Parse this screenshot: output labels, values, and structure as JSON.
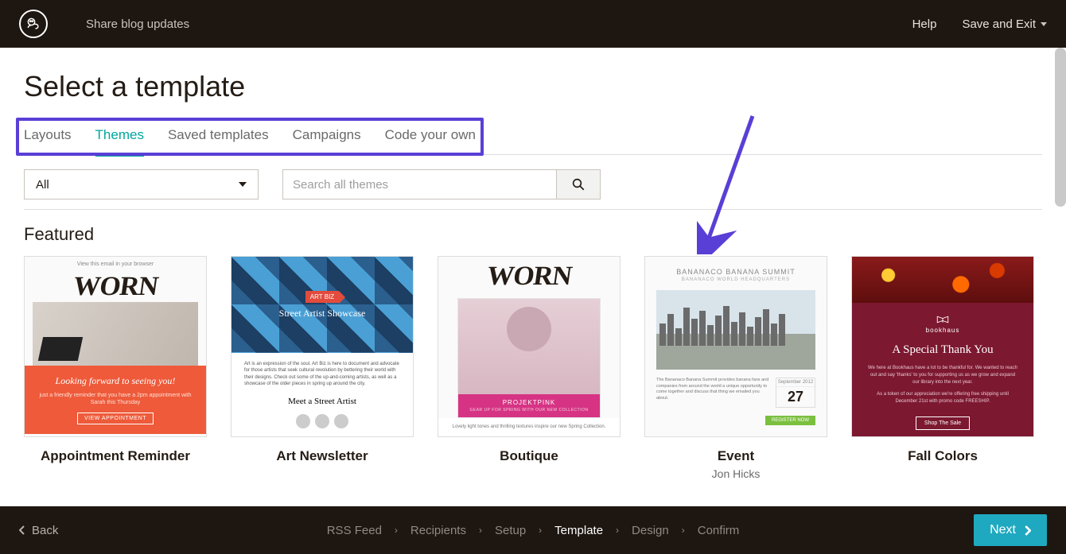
{
  "header": {
    "campaign_name": "Share blog updates",
    "help": "Help",
    "save_exit": "Save and Exit"
  },
  "page": {
    "title": "Select a template"
  },
  "tabs": {
    "layouts": "Layouts",
    "themes": "Themes",
    "saved": "Saved templates",
    "campaigns": "Campaigns",
    "code": "Code your own",
    "active": "themes"
  },
  "filter": {
    "dropdown_value": "All",
    "search_placeholder": "Search all themes"
  },
  "section": {
    "featured": "Featured"
  },
  "templates": [
    {
      "title": "Appointment Reminder",
      "preview": {
        "top_note": "View this email in your browser",
        "logo": "WORN",
        "headline": "Looking forward to seeing you!",
        "body": "just a friendly reminder that you have a 2pm appointment with Sarah this Thursday",
        "button": "VIEW APPOINTMENT"
      }
    },
    {
      "title": "Art Newsletter",
      "preview": {
        "badge": "ART BIZ",
        "hero": "Street Artist Showcase",
        "body": "Art is an expression of the soul. Art Biz is here to document and advocate for those artists that seek cultural revolution by bettering their world with their designs. Check out some of the up-and-coming artists, as well as a showcase of the older pieces in spring up around the city.",
        "subhead": "Meet a Street Artist"
      }
    },
    {
      "title": "Boutique",
      "preview": {
        "logo": "WORN",
        "brand": "PROJEKTPINK",
        "tag": "GEAR UP FOR SPRING WITH OUR NEW COLLECTION",
        "caption": "Lovely light tones and thrilling textures inspire our new Spring Collection."
      }
    },
    {
      "title": "Event",
      "subtitle": "Jon Hicks",
      "preview": {
        "heading": "BANANACO BANANA SUMMIT",
        "subheading": "BANANACO WORLD HEADQUARTERS",
        "body": "The Bananaco Banana Summit provides banana fans and companies from around the world a unique opportunity to come together and discuss that thing we emailed you about.",
        "month": "September 2012",
        "day": "27",
        "button": "REGISTER NOW"
      }
    },
    {
      "title": "Fall Colors",
      "preview": {
        "brand": "bookhaus",
        "headline": "A Special Thank You",
        "body1": "We here at Bookhaus have a lot to be thankful for. We wanted to reach out and say 'thanks' to you for supporting us as we grow and expand our library into the next year.",
        "body2": "As a token of our appreciation we're offering free shipping until December 21st with promo code FREESHIP.",
        "button": "Shop The Sale"
      }
    }
  ],
  "footer": {
    "back": "Back",
    "steps": [
      "RSS Feed",
      "Recipients",
      "Setup",
      "Template",
      "Design",
      "Confirm"
    ],
    "active_step": "Template",
    "next": "Next"
  }
}
